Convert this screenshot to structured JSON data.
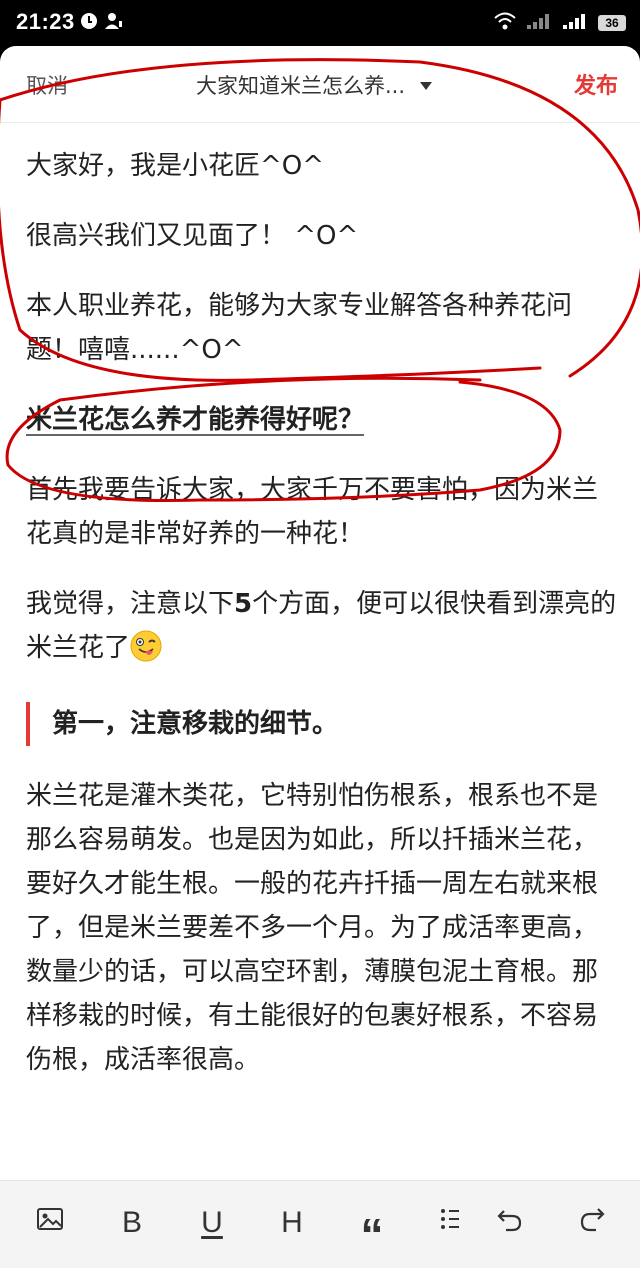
{
  "status_bar": {
    "time": "21:23",
    "battery": "36"
  },
  "header": {
    "cancel_label": "取消",
    "title": "大家知道米兰怎么养...",
    "publish_label": "发布"
  },
  "article": {
    "p1": "大家好，我是小花匠^O^",
    "p2": "很高兴我们又见面了！ ^O^",
    "p3": "本人职业养花，能够为大家专业解答各种养花问题！嘻嘻......^O^",
    "heading": "米兰花怎么养才能养得好呢？",
    "p4": "首先我要告诉大家，大家千万不要害怕，因为米兰花真的是非常好养的一种花！",
    "p5_before": "我觉得，注意以下",
    "p5_number": "5",
    "p5_after": "个方面，便可以很快看到漂亮的米兰花了",
    "quote": "第一，注意移栽的细节。",
    "p6": "米兰花是灌木类花，它特别怕伤根系，根系也不是那么容易萌发。也是因为如此，所以扦插米兰花，要好久才能生根。一般的花卉扦插一周左右就来根了，但是米兰要差不多一个月。为了成活率更高，数量少的话，可以高空环割，薄膜包泥土育根。那样移栽的时候，有土能很好的包裹好根系，不容易伤根，成活率很高。"
  },
  "toolbar": {
    "items": [
      "image-icon",
      "bold-icon",
      "underline-icon",
      "heading-icon",
      "quote-icon",
      "list-icon",
      "undo-icon",
      "redo-icon"
    ],
    "bold": "B",
    "underline": "U",
    "heading": "H",
    "quote": "“"
  },
  "colors": {
    "accent": "#e53935",
    "annotation": "#cc0000",
    "text": "#222222"
  }
}
